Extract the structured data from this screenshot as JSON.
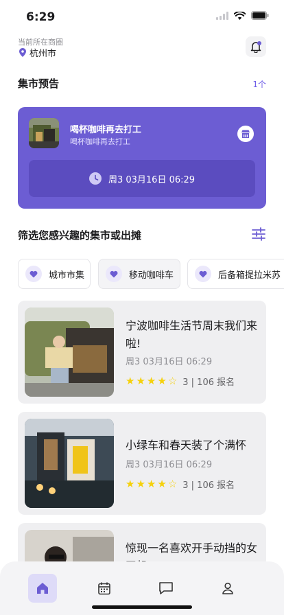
{
  "status_bar": {
    "time": "6:29"
  },
  "location": {
    "label": "当前所在商圈",
    "city": "杭州市"
  },
  "preview": {
    "title": "集市预告",
    "count": "1个",
    "card": {
      "title": "喝杯咖啡再去打工",
      "subtitle": "喝杯咖啡再去打工",
      "datetime": "周3 03月16日 06:29"
    }
  },
  "filter": {
    "title": "筛选您感兴趣的集市或出摊",
    "chips": [
      {
        "label": "城市市集"
      },
      {
        "label": "移动咖啡车"
      },
      {
        "label": "后备箱提拉米苏"
      }
    ]
  },
  "events": [
    {
      "title": "宁波咖啡生活节周末我们来啦!",
      "date": "周3 03月16日 06:29",
      "rating": 4.5,
      "meta": "3 | 106 报名"
    },
    {
      "title": "小绿车和春天装了个满怀",
      "date": "周3 03月16日 06:29",
      "rating": 4.5,
      "meta": "3 | 106 报名"
    },
    {
      "title": "惊现一名喜欢开手动挡的女司机",
      "date": "",
      "rating": 0,
      "meta": ""
    }
  ],
  "tabs": [
    {
      "icon": "home-icon",
      "active": true
    },
    {
      "icon": "calendar-icon",
      "active": false
    },
    {
      "icon": "chat-icon",
      "active": false
    },
    {
      "icon": "profile-icon",
      "active": false
    }
  ],
  "colors": {
    "accent": "#6c5dd3",
    "star": "#f5d10d",
    "card_bg": "#efeff1"
  }
}
